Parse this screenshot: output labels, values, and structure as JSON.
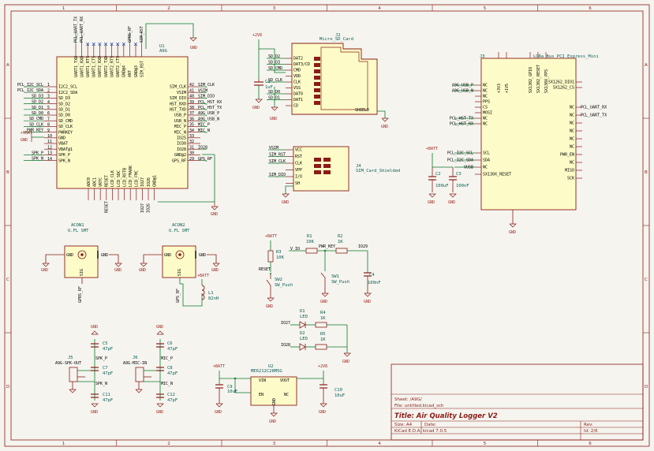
{
  "frame": {
    "cols": [
      "1",
      "2",
      "3",
      "4",
      "5",
      "6"
    ],
    "rows": [
      "A",
      "B",
      "C",
      "D"
    ]
  },
  "title_block": {
    "sheet": "Sheet: /A9G/",
    "file": "File: untitled.kicad_sch",
    "title": "Title: Air Quality Logger V2",
    "size": "Size: A4",
    "date": "Date:",
    "rev": "Rev:",
    "tool": "KiCad E.D.A.  kicad 7.0.5",
    "id": "Id: 2/6"
  },
  "u1": {
    "ref": "U1",
    "value": "A9G",
    "left_pins": [
      {
        "num": "1",
        "name": "I2C2_SCL",
        "net": "PCL_I2C_SCL"
      },
      {
        "num": "2",
        "name": "I2C2_SDA",
        "net": "PCL_I2C_SDA"
      },
      {
        "num": "3",
        "name": "SD_D3",
        "net": "SD_D3"
      },
      {
        "num": "4",
        "name": "SD_D2",
        "net": "SD_D2"
      },
      {
        "num": "5",
        "name": "SD_D1",
        "net": "SD_D1"
      },
      {
        "num": "6",
        "name": "SD_D0",
        "net": "SD_D0"
      },
      {
        "num": "7",
        "name": "SD_CMD",
        "net": "SD_CMD"
      },
      {
        "num": "8",
        "name": "SD_CLK",
        "net": "SD_CLK"
      },
      {
        "num": "9",
        "name": "PWRKEY",
        "net": "PWR_KEY"
      },
      {
        "num": "10",
        "name": "GND",
        "net": ""
      },
      {
        "num": "11",
        "name": "VBAT",
        "net": ""
      },
      {
        "num": "12",
        "name": "VBAT@1",
        "net": ""
      },
      {
        "num": "13",
        "name": "SPK_P",
        "net": "SPK_P"
      },
      {
        "num": "14",
        "name": "SPK_N",
        "net": "SPK_N"
      }
    ],
    "right_pins": [
      {
        "num": "42",
        "name": "SIM_CLK",
        "net": "SIM_CLK"
      },
      {
        "num": "41",
        "name": "VSIM",
        "net": "VSIM"
      },
      {
        "num": "40",
        "name": "SIM_DIO",
        "net": "SIM_DIO"
      },
      {
        "num": "39",
        "name": "HST_RXD",
        "net": "PCL_HST_RX"
      },
      {
        "num": "38",
        "name": "HST_TXD",
        "net": "PCL_HST_TX"
      },
      {
        "num": "37",
        "name": "USB_P",
        "net": "A9G_USB_P"
      },
      {
        "num": "36",
        "name": "USB_N",
        "net": "A9G_USB_N"
      },
      {
        "num": "35",
        "name": "MIC_P",
        "net": "MIC_P"
      },
      {
        "num": "34",
        "name": "MIC_N",
        "net": "MIC_N"
      },
      {
        "num": "33",
        "name": "IO25",
        "net": ""
      },
      {
        "num": "32",
        "name": "IO30",
        "net": ""
      },
      {
        "num": "31",
        "name": "IO28",
        "net": "IO28"
      },
      {
        "num": "30",
        "name": "GND@2",
        "net": ""
      },
      {
        "num": "29",
        "name": "GPS_RF",
        "net": "GPS_RF"
      }
    ],
    "top_pins": [
      "UART1_TXD",
      "UART1_RXD",
      "UART1_RTS",
      "UART1_CTS",
      "UART2_RXD",
      "UART2_TXD",
      "UART2_RTS",
      "UART2_CTS",
      "GND@4",
      "ANT",
      "GND@3",
      "SIM_RST"
    ],
    "top_nets": [
      "PCL_UART_TX",
      "PCL_UART_RX",
      "",
      "",
      "",
      "",
      "",
      "",
      "",
      "GPRS_RF",
      "",
      "SIM_RST"
    ],
    "bottom_pins": [
      "ADC0",
      "ADC1",
      "VRTC",
      "RESET",
      "LCD_CLK",
      "LCD_SDC",
      "LCD_RSTB",
      "LCD_FMARK",
      "LCD_FMC",
      "IO27",
      "IO26",
      "GND@1"
    ],
    "bottom_nets": [
      "",
      "",
      "",
      "RESET",
      "",
      "",
      "",
      "",
      "",
      "IO27",
      "IO26",
      ""
    ]
  },
  "j2": {
    "ref": "J2",
    "value": "Micro_SD_Card",
    "pins": [
      "DAT2",
      "DAT3/CD",
      "CMD",
      "VDD",
      "CLK",
      "VSS",
      "DAT0",
      "DAT1",
      "CD"
    ],
    "nets": [
      "SD_D2",
      "SD_D3",
      "SD_CMD",
      "",
      "SD_CLK",
      "",
      "SD_D0",
      "SD_D1",
      ""
    ],
    "shield": "SHIELD"
  },
  "j3": {
    "ref": "J3",
    "value": "LORa_Bus_PCI_Express_Mini",
    "top_pins": [
      "+3V3",
      "+1V5",
      "SX1302_GPIO",
      "SX1302_RESET",
      "SX130X_PPS"
    ],
    "left_pins": [
      {
        "name": "NC",
        "net": "A9G_USB_P"
      },
      {
        "name": "NC",
        "net": "A9G_USB_N"
      },
      {
        "name": "NC",
        "net": ""
      },
      {
        "name": "PPS",
        "net": ""
      },
      {
        "name": "CS",
        "net": ""
      },
      {
        "name": "MOSI",
        "net": ""
      },
      {
        "name": "NC",
        "net": "PCL_HST_TX"
      },
      {
        "name": "NC",
        "net": "PCL_HST_RX"
      },
      {
        "name": "SCL",
        "net": "PCL_I2C_SCL"
      },
      {
        "name": "SDA",
        "net": "PCL_I2C_SDA"
      },
      {
        "name": "NC",
        "net": "VUSB"
      },
      {
        "name": "SX130X_RESET",
        "net": ""
      }
    ],
    "right_pins": [
      {
        "name": "SX1262_DIO1",
        "net": ""
      },
      {
        "name": "SX1262_CS",
        "net": ""
      },
      {
        "name": "NC",
        "net": "PCL_UART_RX"
      },
      {
        "name": "NC",
        "net": "PCL_UART_TX"
      },
      {
        "name": "NC",
        "net": ""
      },
      {
        "name": "NC",
        "net": ""
      },
      {
        "name": "NC",
        "net": ""
      },
      {
        "name": "NC",
        "net": ""
      },
      {
        "name": "PWR_EN",
        "net": ""
      },
      {
        "name": "NC",
        "net": ""
      },
      {
        "name": "MISO",
        "net": ""
      },
      {
        "name": "SCK",
        "net": ""
      }
    ],
    "gnd": "GND"
  },
  "j4": {
    "ref": "J4",
    "value": "SIM_Card_Shielded",
    "pins": [
      "VCC",
      "RST",
      "CLK",
      "VPP",
      "I/O",
      "SH"
    ],
    "nets": [
      "VSIM",
      "SIM_RST",
      "SIM_CLK",
      "",
      "SIM_DIO",
      ""
    ]
  },
  "acon1": {
    "ref": "ACON1",
    "value": "U.FL SMT",
    "net": "GPRS_RF"
  },
  "acon2": {
    "ref": "ACON2",
    "value": "U.FL SMT",
    "net": "GPS_RF"
  },
  "l1": {
    "ref": "L1",
    "value": "82nH"
  },
  "u2": {
    "ref": "U2",
    "value": "ME6212C28M5G",
    "pins": [
      "VIN",
      "VOUT",
      "EN",
      "GND",
      "NC"
    ]
  },
  "caps": {
    "c1": {
      "ref": "C1",
      "value": "1uF"
    },
    "c2": {
      "ref": "C2",
      "value": "100uF"
    },
    "c3": {
      "ref": "C3",
      "value": "100nF"
    },
    "c4": {
      "ref": "C4",
      "value": "100nF"
    },
    "c5": {
      "ref": "C5",
      "value": "47pF"
    },
    "c6": {
      "ref": "C6",
      "value": "47pF"
    },
    "c7": {
      "ref": "C7",
      "value": "47pF"
    },
    "c8": {
      "ref": "C8",
      "value": "47pF"
    },
    "c9": {
      "ref": "C9",
      "value": "10uF"
    },
    "c10": {
      "ref": "C10",
      "value": "10uF"
    },
    "c11": {
      "ref": "C11",
      "value": "47pF"
    },
    "c12": {
      "ref": "C12",
      "value": "47pF"
    }
  },
  "resistors": {
    "r1": {
      "ref": "R1",
      "value": "10K"
    },
    "r2": {
      "ref": "R2",
      "value": "1K"
    },
    "r3": {
      "ref": "R3",
      "value": "10K"
    },
    "r4": {
      "ref": "R4",
      "value": "1K"
    },
    "r5": {
      "ref": "R5",
      "value": "1K"
    }
  },
  "switches": {
    "sw1": {
      "ref": "SW1",
      "value": "SW_Push"
    },
    "sw2": {
      "ref": "SW2",
      "value": "SW_Push"
    }
  },
  "leds": {
    "d1": {
      "ref": "D1",
      "value": "LED"
    },
    "d2": {
      "ref": "D2",
      "value": "LED"
    }
  },
  "jacks": {
    "j5": {
      "ref": "J5",
      "value": "A9G-SPK-OUT"
    },
    "j6": {
      "ref": "J6",
      "value": "A9G-MIC-IN"
    }
  },
  "power": {
    "gnd": "GND",
    "vbat": "+BATT",
    "v28": "+2V8"
  },
  "nets": {
    "vio": "V_IO",
    "pwrkey": "PWR_KEY",
    "io29": "IO29",
    "io27": "IO27",
    "io28": "IO28",
    "reset": "RESET",
    "spkp": "SPK_P",
    "spkn": "SPK_N",
    "micp": "MIC_P",
    "micn": "MIC_N",
    "gps_rf": "GPS_RF",
    "gprs_rf": "GPRS_RF",
    "sig": "SIG",
    "gnd_pin": "GND",
    "vusb": "VUSB",
    "vbat": "+VBAT",
    "io26": "IO26"
  }
}
